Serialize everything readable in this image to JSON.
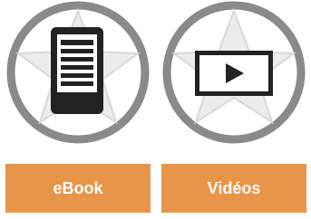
{
  "tiles": [
    {
      "label": "eBook",
      "icon": "ebook-reader-icon"
    },
    {
      "label": "Vidéos",
      "icon": "video-play-icon"
    }
  ],
  "colors": {
    "ring": "#8a8a8a",
    "star": "#ececec",
    "icon_dark": "#222222",
    "button": "#e8954a",
    "button_text": "#ffffff"
  }
}
